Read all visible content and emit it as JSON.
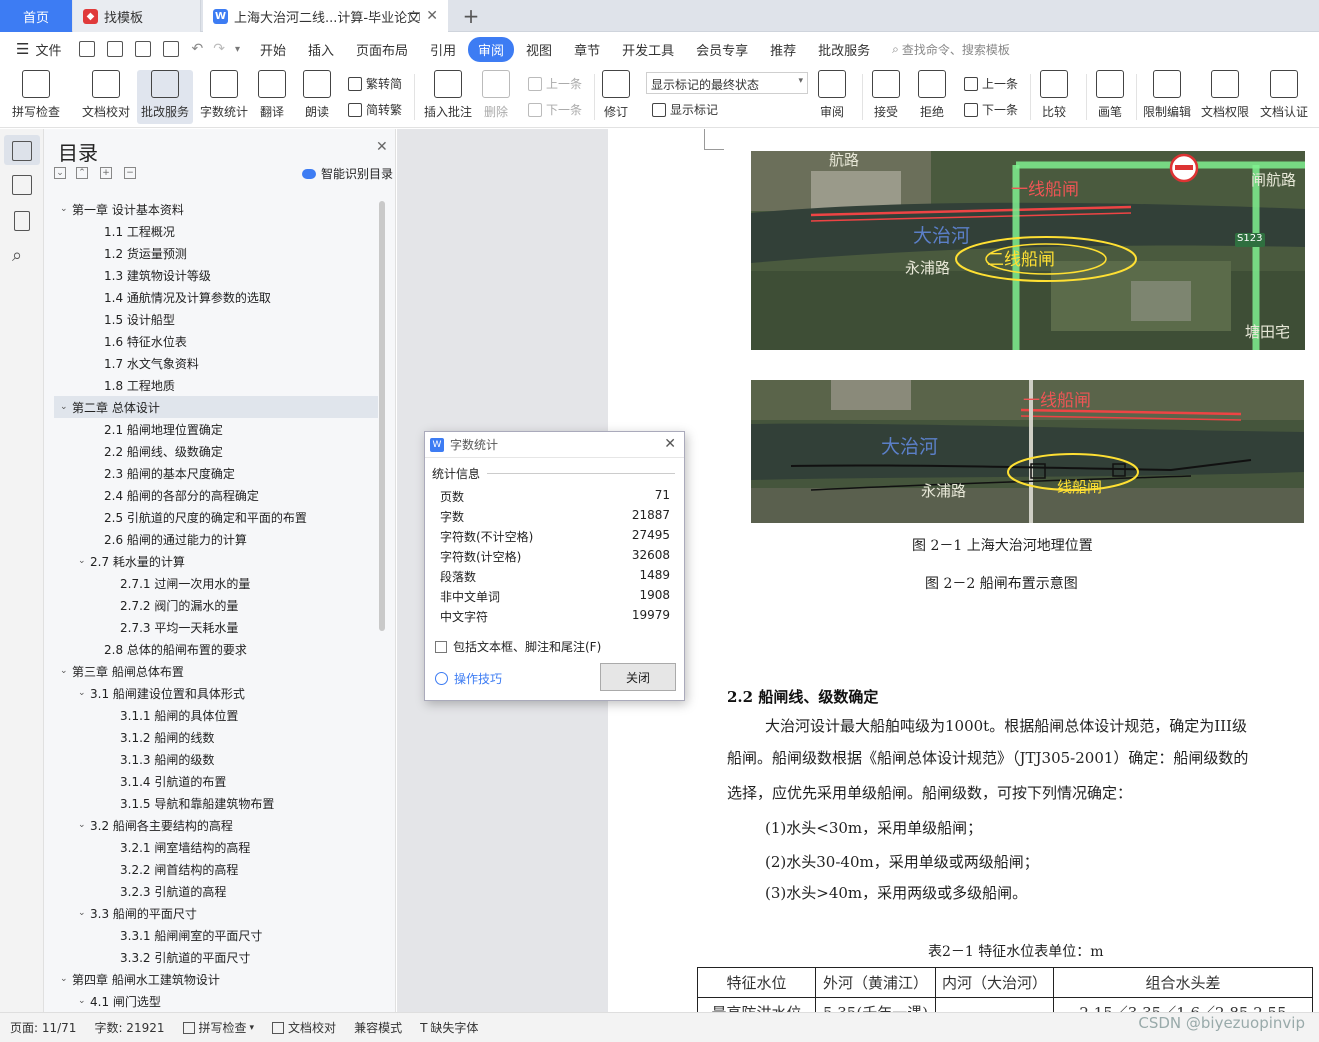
{
  "tabs": {
    "home": "首页",
    "template": "找模板",
    "document": "上海大治河二线...计算-毕业论文"
  },
  "menu": {
    "file": "文件",
    "items": [
      "开始",
      "插入",
      "页面布局",
      "引用",
      "审阅",
      "视图",
      "章节",
      "开发工具",
      "会员专享",
      "推荐",
      "批改服务"
    ],
    "active": "审阅",
    "search": "查找命令、搜索模板"
  },
  "ribbon": {
    "spell": "拼写检查",
    "proof": "文档校对",
    "correct": "批改服务",
    "wordcount": "字数统计",
    "translate": "翻译",
    "read": "朗读",
    "to_trad": "繁转简",
    "to_simp": "简转繁",
    "insert_comment": "插入批注",
    "delete": "删除",
    "prev_comment": "上一条",
    "next_comment": "下一条",
    "revise": "修订",
    "markup_state": "显示标记的最终状态",
    "show_markup": "显示标记",
    "review": "审阅",
    "accept": "接受",
    "reject": "拒绝",
    "prev_change": "上一条",
    "next_change": "下一条",
    "compare": "比较",
    "pen": "画笔",
    "restrict": "限制编辑",
    "permission": "文档权限",
    "certify": "文档认证"
  },
  "toc": {
    "title": "目录",
    "smart": "智能识别目录",
    "items": [
      {
        "text": "第一章  设计基本资料",
        "level": 0,
        "arrow": "v"
      },
      {
        "text": "1.1 工程概况",
        "level": 1
      },
      {
        "text": "1.2 货运量预测",
        "level": 1
      },
      {
        "text": "1.3 建筑物设计等级",
        "level": 1
      },
      {
        "text": "1.4 通航情况及计算参数的选取",
        "level": 1
      },
      {
        "text": "1.5 设计船型",
        "level": 1
      },
      {
        "text": "1.6 特征水位表",
        "level": 1
      },
      {
        "text": "1.7 水文气象资料",
        "level": 1
      },
      {
        "text": "1.8 工程地质",
        "level": 1
      },
      {
        "text": "第二章  总体设计",
        "level": 0,
        "arrow": "v",
        "hl": true
      },
      {
        "text": "2.1 船闸地理位置确定",
        "level": 1
      },
      {
        "text": "2.2 船闸线、级数确定",
        "level": 1
      },
      {
        "text": "2.3 船闸的基本尺度确定",
        "level": 1
      },
      {
        "text": "2.4 船闸的各部分的高程确定",
        "level": 1
      },
      {
        "text": "2.5 引航道的尺度的确定和平面的布置",
        "level": 1
      },
      {
        "text": "2.6 船闸的通过能力的计算",
        "level": 1
      },
      {
        "text": "2.7 耗水量的计算",
        "level": 1,
        "arrow": "v"
      },
      {
        "text": "2.7.1 过闸一次用水的量",
        "level": 2
      },
      {
        "text": "2.7.2 阀门的漏水的量",
        "level": 2
      },
      {
        "text": "2.7.3 平均一天耗水量",
        "level": 2
      },
      {
        "text": "2.8 总体的船闸布置的要求",
        "level": 1
      },
      {
        "text": "第三章  船闸总体布置",
        "level": 0,
        "arrow": "v"
      },
      {
        "text": "3.1 船闸建设位置和具体形式",
        "level": 1,
        "arrow": "v"
      },
      {
        "text": "3.1.1 船闸的具体位置",
        "level": 2
      },
      {
        "text": "3.1.2 船闸的线数",
        "level": 2
      },
      {
        "text": "3.1.3 船闸的级数",
        "level": 2
      },
      {
        "text": "3.1.4 引航道的布置",
        "level": 2
      },
      {
        "text": "3.1.5 导航和靠船建筑物布置",
        "level": 2
      },
      {
        "text": "3.2 船闸各主要结构的高程",
        "level": 1,
        "arrow": "v"
      },
      {
        "text": "3.2.1 闸室墙结构的高程",
        "level": 2
      },
      {
        "text": "3.2.2 闸首结构的高程",
        "level": 2
      },
      {
        "text": "3.2.3 引航道的高程",
        "level": 2
      },
      {
        "text": "3.3 船闸的平面尺寸",
        "level": 1,
        "arrow": "v"
      },
      {
        "text": "3.3.1 船闸闸室的平面尺寸",
        "level": 2
      },
      {
        "text": "3.3.2 引航道的平面尺寸",
        "level": 2
      },
      {
        "text": "第四章  船闸水工建筑物设计",
        "level": 0,
        "arrow": "v"
      },
      {
        "text": "4.1 闸门选型",
        "level": 1,
        "arrow": "v"
      }
    ]
  },
  "dialog": {
    "title": "字数统计",
    "section": "统计信息",
    "stats": [
      {
        "label": "页数",
        "value": "71"
      },
      {
        "label": "字数",
        "value": "21887"
      },
      {
        "label": "字符数(不计空格)",
        "value": "27495"
      },
      {
        "label": "字符数(计空格)",
        "value": "32608"
      },
      {
        "label": "段落数",
        "value": "1489"
      },
      {
        "label": "非中文单词",
        "value": "1908"
      },
      {
        "label": "中文字符",
        "value": "19979"
      }
    ],
    "include": "包括文本框、脚注和尾注(F)",
    "tips": "操作技巧",
    "close": "关闭"
  },
  "doc": {
    "map1_labels": {
      "road1": "航路",
      "road2": "闸航路",
      "lock1": "一线船闸",
      "river": "大治河",
      "lock2": "二线船闸",
      "road3": "永浦路",
      "place": "塘田宅",
      "sign": "S123"
    },
    "map2_labels": {
      "lock1": "一线船闸",
      "river": "大治河",
      "road": "永浦路",
      "lock2": "线船闸"
    },
    "fig1": "图 2－1    上海大治河地理位置",
    "fig2": "图 2－2    船闸布置示意图",
    "heading": "2.2  船闸线、级数确定",
    "para1": "大治河设计最大船舶吨级为1000t。根据船闸总体设计规范，确定为III级",
    "para2": "船闸。船闸级数根据《船闸总体设计规范》（JTJ305-2001）确定：船闸级数的",
    "para3": "选择，应优先采用单级船闸。船闸级数，可按下列情况确定：",
    "item1": "(1)水头<30m，采用单级船闸；",
    "item2": "(2)水头30-40m，采用单级或两级船闸；",
    "item3": "(3)水头>40m，采用两级或多级船闸。",
    "table_caption": "表2－1    特征水位表单位：m",
    "table_head": [
      "特征水位",
      "外河（黄浦江）",
      "内河（大治河）",
      "组合水头差"
    ],
    "table_row1": [
      "最高防洪水位",
      "5.35(千年一遇)",
      "",
      "2.15／3.35／1.6／2.85 2.55"
    ]
  },
  "status": {
    "page": "页面: 11/71",
    "words": "字数: 21921",
    "spell": "拼写检查",
    "proof": "文档校对",
    "compat": "兼容模式",
    "font": "缺失字体"
  },
  "watermark": "CSDN @biyezuopinvip"
}
